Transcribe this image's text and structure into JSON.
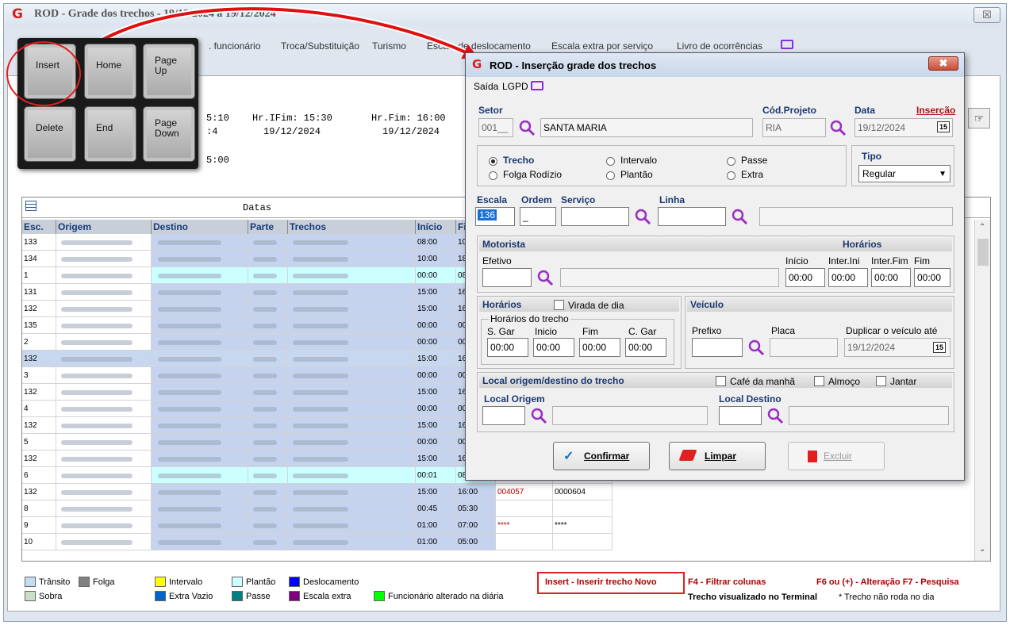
{
  "main_window": {
    "title": "ROD - Grade dos trechos - 19/12/2024 a 19/12/2024",
    "logo_letter": "G",
    "close_symbol": "☒",
    "menu": [
      ". funcionário",
      "Troca/Substituição",
      "Turismo",
      "Escala de deslocamento",
      "Escala extra por serviço",
      "Livro de ocorrências"
    ],
    "info": {
      "hr_ini_frag": "5:10",
      "hr_ifim": "Hr.IFim: 15:30",
      "hr_fim": "Hr.Fim: 16:00",
      "date_frag": ":4",
      "date1": "19/12/2024",
      "date2": "19/12/2024",
      "time_frag": "5:00"
    },
    "grid": {
      "caption": "Datas",
      "columns": [
        "Esc.",
        "Origem",
        "Destino",
        "Parte",
        "Trechos",
        "Início",
        "Fi"
      ],
      "rows": [
        {
          "esc": "133",
          "ini": "08:00",
          "fim": "10",
          "c7": "",
          "c8": ""
        },
        {
          "esc": "134",
          "ini": "10:00",
          "fim": "18",
          "c7": "",
          "c8": ""
        },
        {
          "esc": "1",
          "ini": "00:00",
          "fim": "08",
          "c7": "",
          "c8": ""
        },
        {
          "esc": "131",
          "ini": "15:00",
          "fim": "16",
          "c7": "",
          "c8": ""
        },
        {
          "esc": "132",
          "ini": "15:00",
          "fim": "16",
          "c7": "",
          "c8": ""
        },
        {
          "esc": "135",
          "ini": "00:00",
          "fim": "00",
          "c7": "",
          "c8": ""
        },
        {
          "esc": "2",
          "ini": "00:00",
          "fim": "00",
          "c7": "",
          "c8": ""
        },
        {
          "esc": "132",
          "ini": "15:00",
          "fim": "16",
          "c7": "",
          "c8": ""
        },
        {
          "esc": "3",
          "ini": "00:00",
          "fim": "00",
          "c7": "",
          "c8": ""
        },
        {
          "esc": "132",
          "ini": "15:00",
          "fim": "16",
          "c7": "",
          "c8": ""
        },
        {
          "esc": "4",
          "ini": "00:00",
          "fim": "00",
          "c7": "",
          "c8": ""
        },
        {
          "esc": "132",
          "ini": "15:00",
          "fim": "16",
          "c7": "",
          "c8": ""
        },
        {
          "esc": "5",
          "ini": "00:00",
          "fim": "00",
          "c7": "",
          "c8": ""
        },
        {
          "esc": "132",
          "ini": "15:00",
          "fim": "16",
          "c7": "",
          "c8": ""
        },
        {
          "esc": "6",
          "ini": "00:01",
          "fim": "08",
          "c7": "",
          "c8": ""
        },
        {
          "esc": "132",
          "ini": "15:00",
          "fim": "16:00",
          "c7": "004057",
          "c8": "0000604"
        },
        {
          "esc": "8",
          "ini": "00:45",
          "fim": "05:30",
          "c7": "",
          "c8": ""
        },
        {
          "esc": "9",
          "ini": "01:00",
          "fim": "07:00",
          "c7": "****",
          "c8": "****"
        },
        {
          "esc": "10",
          "ini": "01:00",
          "fim": "05:00",
          "c7": "",
          "c8": ""
        }
      ]
    },
    "legend": {
      "items": [
        {
          "label": "Trânsito",
          "color": "#c5dcf0"
        },
        {
          "label": "Folga",
          "color": "#808080"
        },
        {
          "label": "Intervalo",
          "color": "#ffff00"
        },
        {
          "label": "Plantão",
          "color": "#ccffff"
        },
        {
          "label": "Deslocamento",
          "color": "#0000ff"
        },
        {
          "label": "Sobra",
          "color": "#c8e0c8"
        },
        {
          "label": "Extra Vazio",
          "color": "#0066cc"
        },
        {
          "label": "Passe",
          "color": "#008080"
        },
        {
          "label": "Escala extra",
          "color": "#800080"
        },
        {
          "label": "Funcionário alterado na diária",
          "color": "#00ff00"
        }
      ],
      "insert_hint": "Insert - Inserir trecho Novo",
      "f4_hint": "F4 - Filtrar colunas",
      "f6_hint": "F6 ou (+) - Alteração  F7 - Pesquisa",
      "terminal_hint": "Trecho visualizado no Terminal",
      "star_hint": "* Trecho não roda no dia"
    }
  },
  "keyboard_overlay": {
    "keys": [
      "Insert",
      "Home",
      "Page Up",
      "Delete",
      "End",
      "Page Down"
    ]
  },
  "dialog": {
    "title": "ROD - Inserção grade dos trechos",
    "close_symbol": "✖",
    "menu": [
      "Saída",
      "LGPD"
    ],
    "setor_label": "Setor",
    "setor_code": "001__",
    "setor_name": "SANTA MARIA",
    "cod_projeto_label": "Cód.Projeto",
    "cod_projeto_value": "RIA",
    "data_label": "Data",
    "insercao_label": "Inserção",
    "data_value": "19/12/2024",
    "cal_icon": "15",
    "radios": [
      {
        "label": "Trecho",
        "checked": true
      },
      {
        "label": "Intervalo",
        "checked": false
      },
      {
        "label": "Passe",
        "checked": false
      },
      {
        "label": "Folga Rodízio",
        "checked": false
      },
      {
        "label": "Plantão",
        "checked": false
      },
      {
        "label": "Extra",
        "checked": false
      }
    ],
    "tipo_label": "Tipo",
    "tipo_value": "Regular",
    "escala_label": "Escala",
    "escala_value": "136",
    "ordem_label": "Ordem",
    "ordem_value": "_",
    "servico_label": "Serviço",
    "linha_label": "Linha",
    "motorista_label": "Motorista",
    "horarios_label": "Horários",
    "efetivo_label": "Efetivo",
    "mot_times": [
      {
        "label": "Início",
        "value": "00:00"
      },
      {
        "label": "Inter.Ini",
        "value": "00:00"
      },
      {
        "label": "Inter.Fim",
        "value": "00:00"
      },
      {
        "label": "Fim",
        "value": "00:00"
      }
    ],
    "horarios2_label": "Horários",
    "virada_label": "Virada de dia",
    "horarios_trecho_label": "Horários do trecho",
    "trecho_times": [
      {
        "label": "S. Gar",
        "value": "00:00"
      },
      {
        "label": "Inicio",
        "value": "00:00"
      },
      {
        "label": "Fim",
        "value": "00:00"
      },
      {
        "label": "C. Gar",
        "value": "00:00"
      }
    ],
    "veiculo_label": "Veículo",
    "prefixo_label": "Prefixo",
    "placa_label": "Placa",
    "duplicar_label": "Duplicar o veículo até",
    "duplicar_value": "19/12/2024",
    "local_header": "Local origem/destino do trecho",
    "cafe_label": "Café da manhã",
    "almoco_label": "Almoço",
    "jantar_label": "Jantar",
    "local_origem_label": "Local Origem",
    "local_destino_label": "Local Destino",
    "confirmar_label": "Confirmar",
    "limpar_label": "Limpar",
    "excluir_label": "Excluir"
  }
}
